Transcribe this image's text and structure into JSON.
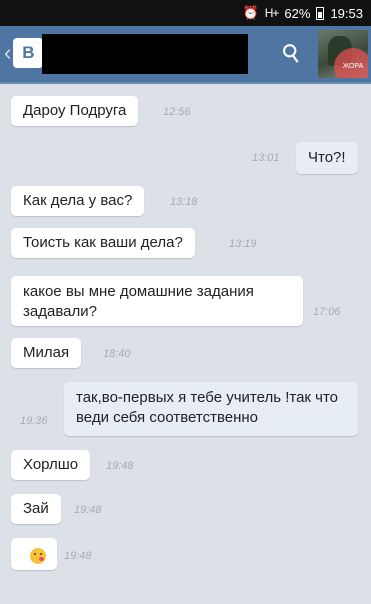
{
  "status_bar": {
    "signal": "H+",
    "battery": "62%",
    "time": "19:53"
  },
  "header": {
    "back_label": "‹",
    "logo": "В",
    "attach_icon": "paperclip-icon"
  },
  "messages": [
    {
      "text": "Дароу Подруга",
      "time": "12:56",
      "direction": "in"
    },
    {
      "text": "Что?!",
      "time": "13:01",
      "direction": "out"
    },
    {
      "text": "Как дела у вас?",
      "time": "13:18",
      "direction": "in"
    },
    {
      "text": "Тоисть как ваши дела?",
      "time": "13:19",
      "direction": "in"
    },
    {
      "text": "какое вы мне домашние задания задавали?",
      "time": "17:06",
      "direction": "in"
    },
    {
      "text": "Милая",
      "time": "18:40",
      "direction": "in"
    },
    {
      "text": "так,во-первых я тебе учитель !так что веди себя соответственно",
      "time": "19:36",
      "direction": "out"
    },
    {
      "text": "Хорлшо",
      "time": "19:48",
      "direction": "in"
    },
    {
      "text": "Зай",
      "time": "19:48",
      "direction": "in"
    },
    {
      "text": "",
      "emoji": "kiss-emoji-icon",
      "time": "19:48",
      "direction": "in"
    }
  ]
}
